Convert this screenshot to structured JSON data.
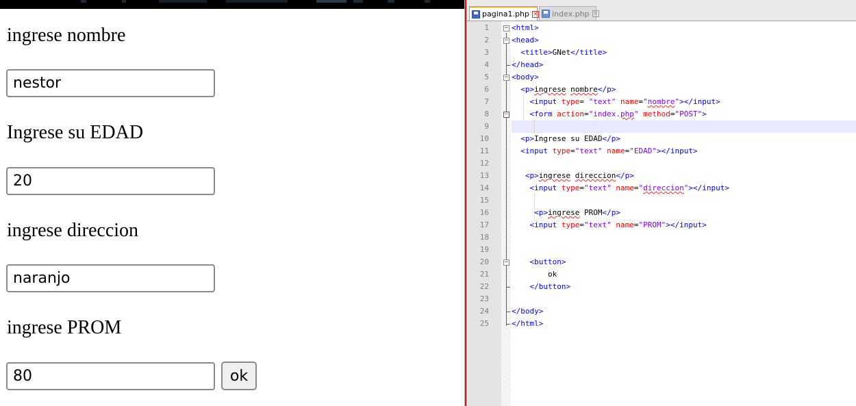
{
  "browser": {
    "fields": [
      {
        "label": "ingrese nombre",
        "value": "nestor"
      },
      {
        "label": "Ingrese su EDAD",
        "value": "20"
      },
      {
        "label": "ingrese direccion",
        "value": "naranjo"
      },
      {
        "label": "ingrese PROM",
        "value": "80"
      }
    ],
    "button_label": "ok"
  },
  "editor": {
    "tabs": [
      {
        "name": "pagina1.php",
        "active": true
      },
      {
        "name": "index.php",
        "active": false
      }
    ],
    "current_line": 9,
    "lines": [
      {
        "n": "1",
        "text": "<html>"
      },
      {
        "n": "2",
        "text": "<head>"
      },
      {
        "n": "3",
        "text": "  <title>GNet</title>"
      },
      {
        "n": "4",
        "text": "</head>"
      },
      {
        "n": "5",
        "text": "<body>"
      },
      {
        "n": "6",
        "text": "  <p>ingrese nombre</p>"
      },
      {
        "n": "7",
        "text": "    <input type= \"text\" name=\"nombre\"></input>"
      },
      {
        "n": "8",
        "text": "    <form action=\"index.php\" method=\"POST\">"
      },
      {
        "n": "9",
        "text": ""
      },
      {
        "n": "10",
        "text": "  <p>Ingrese su EDAD</p>"
      },
      {
        "n": "11",
        "text": "  <input type=\"text\" name=\"EDAD\"></input>"
      },
      {
        "n": "12",
        "text": ""
      },
      {
        "n": "13",
        "text": "   <p>ingrese direccion</p>"
      },
      {
        "n": "14",
        "text": "    <input type=\"text\" name=\"direccion\"></input>"
      },
      {
        "n": "15",
        "text": ""
      },
      {
        "n": "16",
        "text": "     <p>ingrese PROM</p>"
      },
      {
        "n": "17",
        "text": "    <input type=\"text\" name=\"PROM\"></input>"
      },
      {
        "n": "18",
        "text": ""
      },
      {
        "n": "19",
        "text": ""
      },
      {
        "n": "20",
        "text": "    <button>"
      },
      {
        "n": "21",
        "text": "        ok"
      },
      {
        "n": "22",
        "text": "    </button>"
      },
      {
        "n": "23",
        "text": ""
      },
      {
        "n": "24",
        "text": "</body>"
      },
      {
        "n": "25",
        "text": "</html>"
      }
    ]
  }
}
